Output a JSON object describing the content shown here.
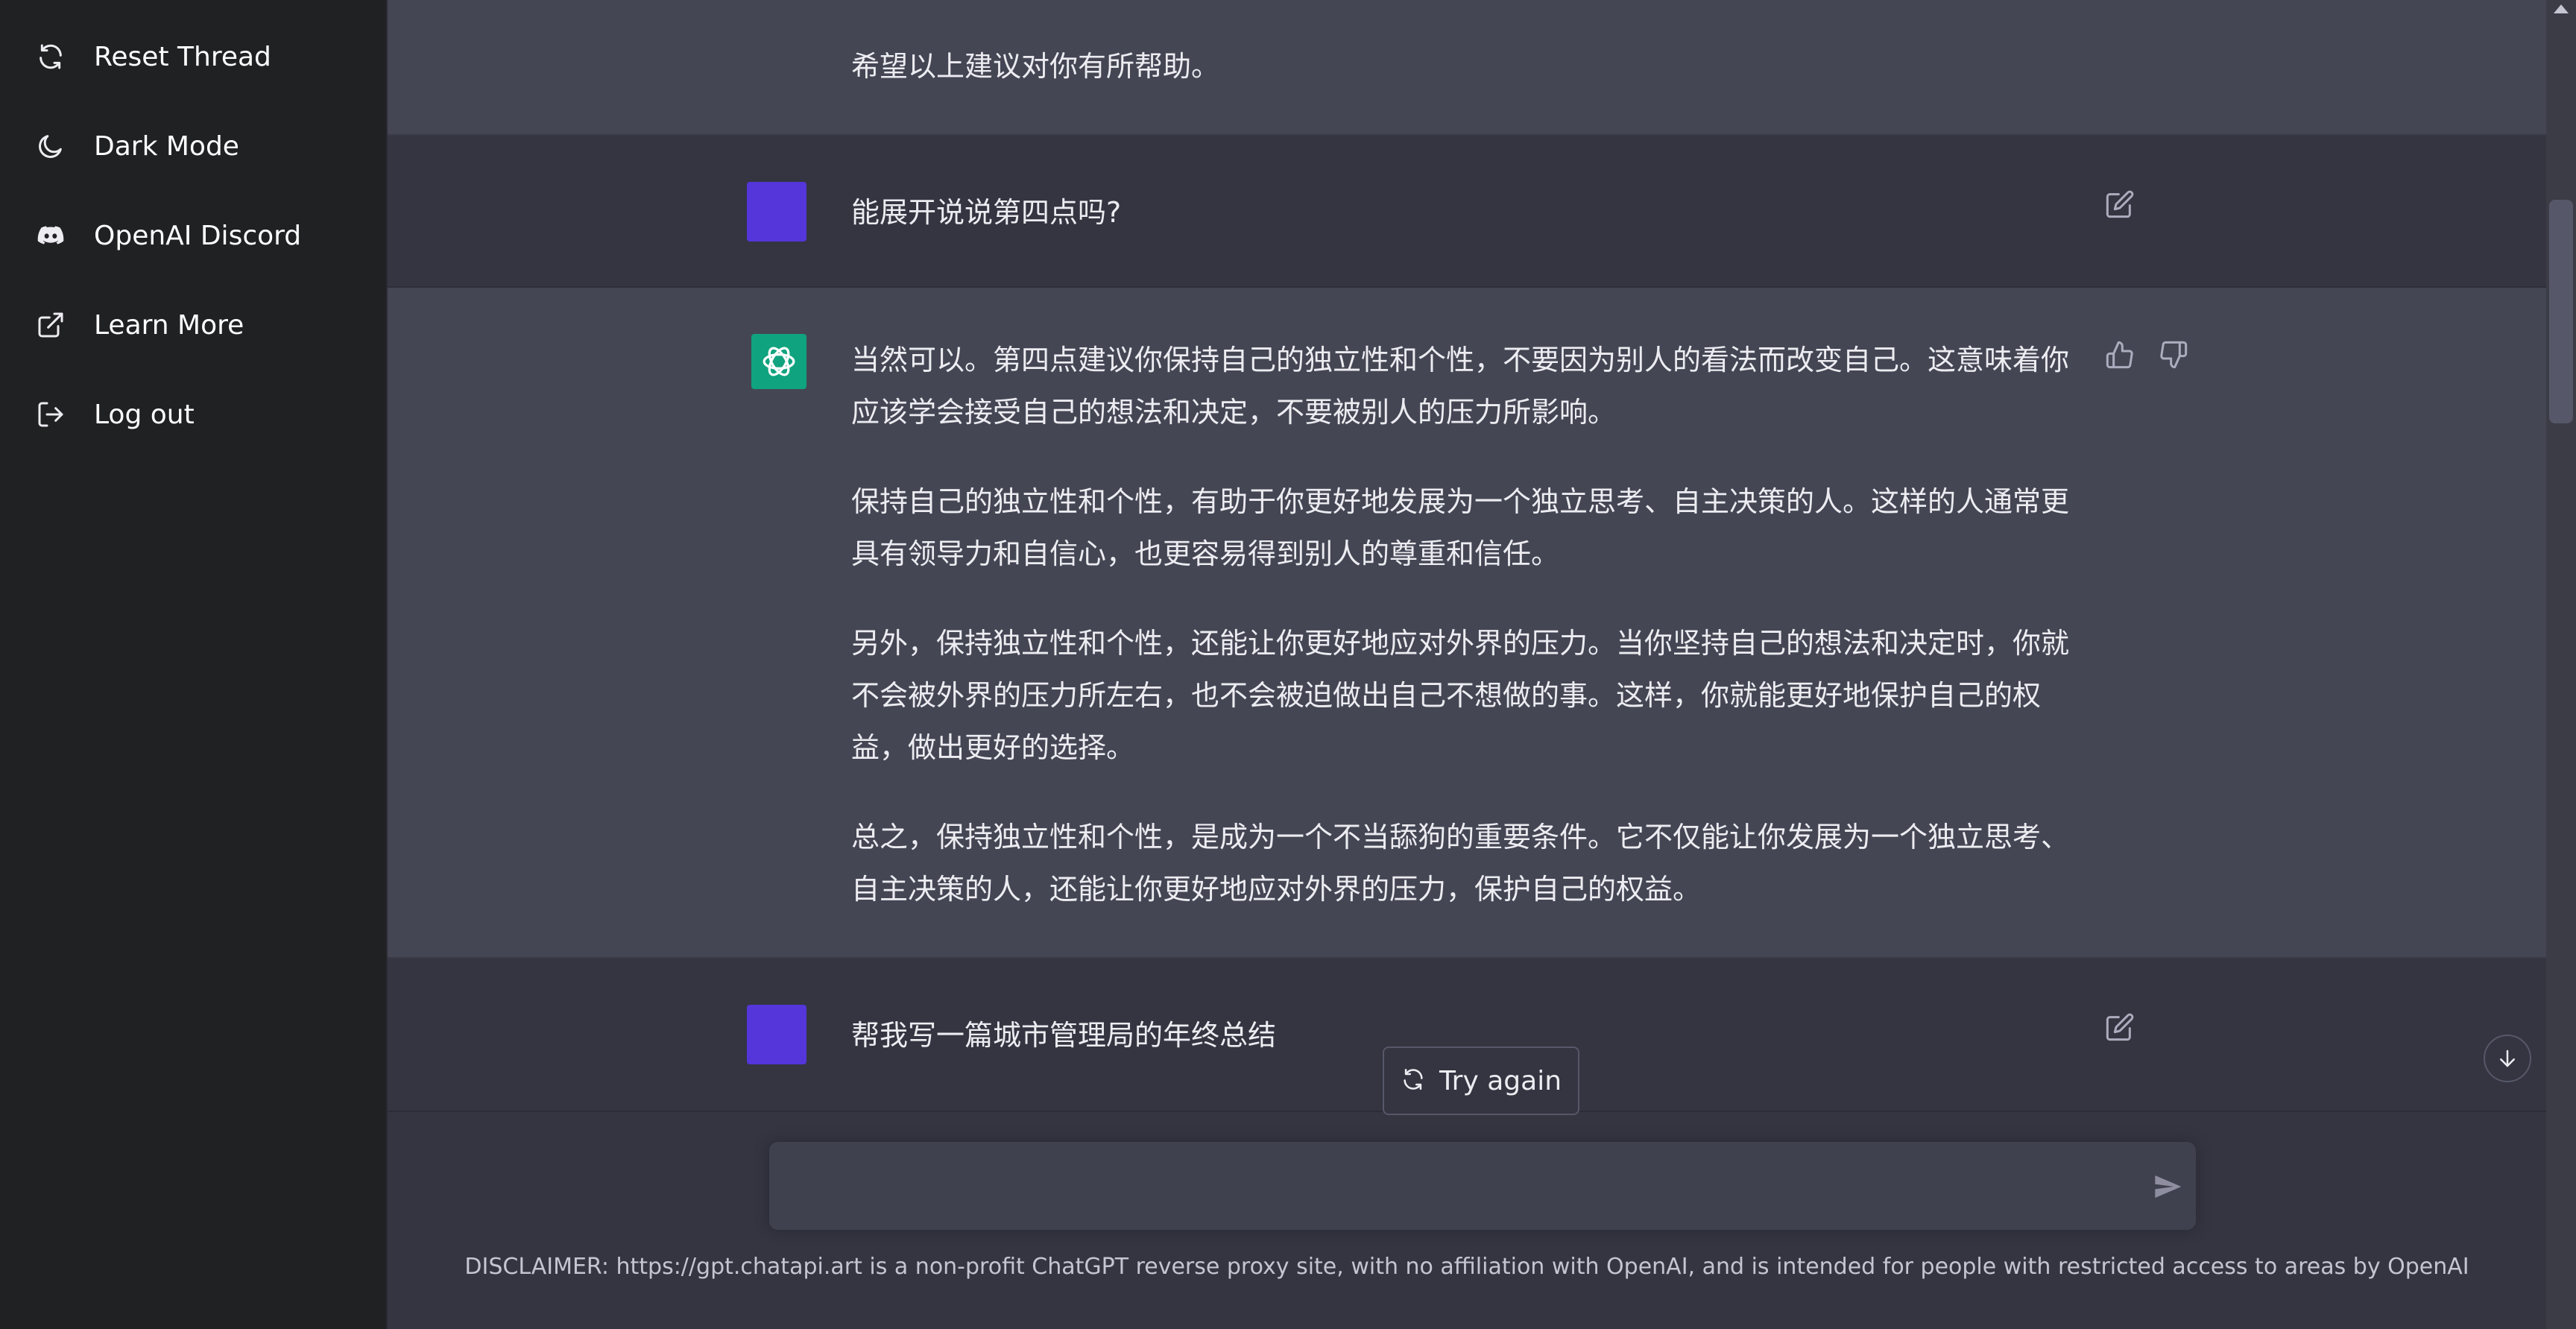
{
  "sidebar": {
    "items": [
      {
        "label": "Reset Thread",
        "icon": "refresh-icon"
      },
      {
        "label": "Dark Mode",
        "icon": "moon-icon"
      },
      {
        "label": "OpenAI Discord",
        "icon": "discord-icon"
      },
      {
        "label": "Learn More",
        "icon": "external-link-icon"
      },
      {
        "label": "Log out",
        "icon": "logout-icon"
      }
    ]
  },
  "conversation": {
    "top_partial": "希望以上建议对你有所帮助。",
    "user_message_1": "能展开说说第四点吗?",
    "assistant_message": [
      "当然可以。第四点建议你保持自己的独立性和个性，不要因为别人的看法而改变自己。这意味着你应该学会接受自己的想法和决定，不要被别人的压力所影响。",
      "保持自己的独立性和个性，有助于你更好地发展为一个独立思考、自主决策的人。这样的人通常更具有领导力和自信心，也更容易得到别人的尊重和信任。",
      "另外，保持独立性和个性，还能让你更好地应对外界的压力。当你坚持自己的想法和决定时，你就不会被外界的压力所左右，也不会被迫做出自己不想做的事。这样，你就能更好地保护自己的权益，做出更好的选择。",
      "总之，保持独立性和个性，是成为一个不当舔狗的重要条件。它不仅能让你发展为一个独立思考、自主决策的人，还能让你更好地应对外界的压力，保护自己的权益。"
    ],
    "user_message_2": "帮我写一篇城市管理局的年终总结"
  },
  "controls": {
    "try_again_label": "Try again",
    "input_value": "",
    "disclaimer": "DISCLAIMER: https://gpt.chatapi.art is a non-profit ChatGPT reverse proxy site, with no affiliation with OpenAI, and is intended for people with restricted access to areas by OpenAI"
  },
  "colors": {
    "sidebar_bg": "#202123",
    "main_bg": "#343541",
    "ai_row_bg": "#444654",
    "user_avatar": "#5436da",
    "ai_avatar": "#10a37f"
  }
}
